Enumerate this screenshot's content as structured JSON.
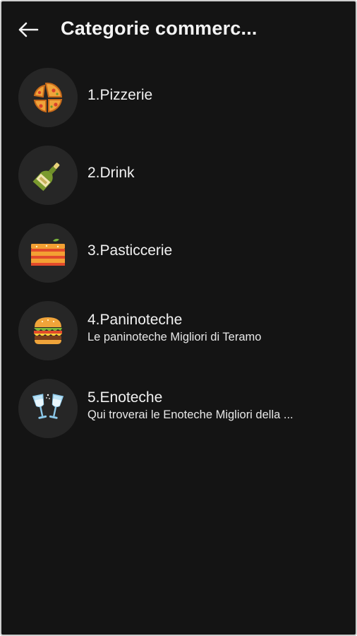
{
  "header": {
    "title": "Categorie commerc..."
  },
  "categories": [
    {
      "title": "1.Pizzerie",
      "subtitle": "",
      "icon": "pizza-icon"
    },
    {
      "title": "2.Drink",
      "subtitle": "",
      "icon": "bottle-icon"
    },
    {
      "title": "3.Pasticcerie",
      "subtitle": "",
      "icon": "cake-icon"
    },
    {
      "title": "4.Paninoteche",
      "subtitle": "Le paninoteche Migliori di Teramo",
      "icon": "burger-icon"
    },
    {
      "title": "5.Enoteche",
      "subtitle": "Qui troverai le Enoteche Migliori della ...",
      "icon": "wine-glasses-icon"
    }
  ],
  "colors": {
    "background": "#141414",
    "avatar_bg": "#262626",
    "text": "#f1f1f1"
  }
}
